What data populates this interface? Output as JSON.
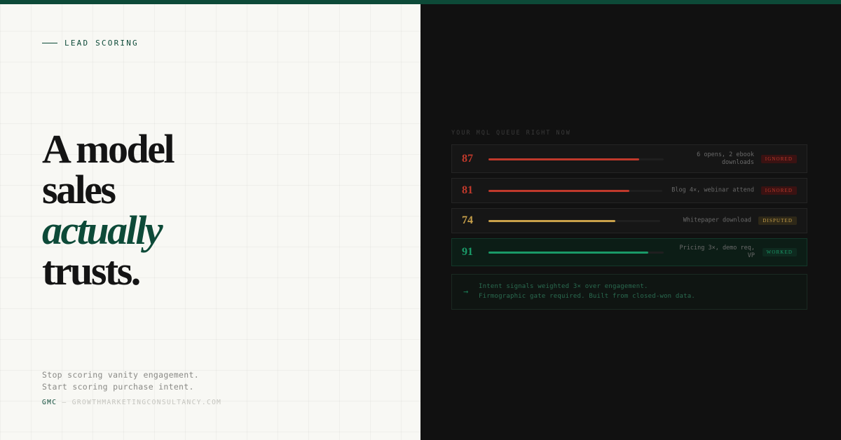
{
  "eyebrow": "LEAD SCORING",
  "headline": {
    "line1": "A model",
    "line2": "sales",
    "line3": "actually",
    "line4": "trusts."
  },
  "subtitle": {
    "line1": "Stop scoring vanity engagement.",
    "line2": "Start scoring purchase intent."
  },
  "brand": {
    "short": "GMC",
    "separator": " — ",
    "site": "GROWTHMARKETINGCONSULTANCY.COM"
  },
  "queue": {
    "title": "YOUR MQL QUEUE RIGHT NOW",
    "rows": [
      {
        "score": "87",
        "fill_fraction": 0.86,
        "desc_lines": [
          "6 opens, 2 ebook",
          "downloads"
        ],
        "badge": "IGNORED",
        "color": "#c0392b",
        "badge_bg": "#3a1212",
        "badge_color": "#c0392b"
      },
      {
        "score": "81",
        "fill_fraction": 0.81,
        "desc_lines": [
          "Blog 4×, webinar attend"
        ],
        "badge": "IGNORED",
        "color": "#c0392b",
        "badge_bg": "#3a1212",
        "badge_color": "#c0392b"
      },
      {
        "score": "74",
        "fill_fraction": 0.74,
        "desc_lines": [
          "Whitepaper download"
        ],
        "badge": "DISPUTED",
        "color": "#c9a14a",
        "badge_bg": "#2e2818",
        "badge_color": "#c9a14a"
      },
      {
        "score": "91",
        "fill_fraction": 0.91,
        "desc_lines": [
          "Pricing 3×, demo req,",
          "VP"
        ],
        "badge": "WORKED",
        "color": "#1a9a68",
        "badge_bg": "#0e2a1f",
        "badge_color": "#1a9a68"
      }
    ]
  },
  "note": {
    "arrow": "→",
    "line1": "Intent signals weighted 3× over engagement.",
    "line2": "Firmographic gate required. Built from closed-won data."
  },
  "colors": {
    "brand_green": "#0d4a38",
    "left_bg": "#f8f8f4",
    "right_bg": "#111111"
  }
}
